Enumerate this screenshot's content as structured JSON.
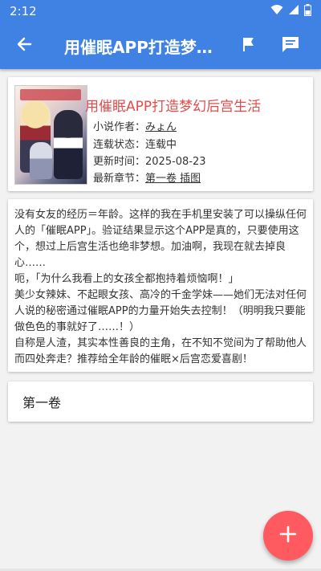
{
  "status_bar": {
    "time": "2:12"
  },
  "app_bar": {
    "title": "用催眠APP打造梦…",
    "back_icon": "arrow-left-icon",
    "actions": [
      "flag-icon",
      "comment-icon"
    ]
  },
  "book": {
    "title": "用催眠APP打造梦幻后宫生活",
    "author_label": "小说作者：",
    "author": "みょん",
    "status_label": "连载状态：",
    "status": "连载中",
    "updated_label": "更新时间：",
    "updated": "2025-08-23",
    "latest_label": "最新章节：",
    "latest": "第一卷 插图"
  },
  "description": {
    "paragraphs": [
      "没有女友的经历＝年龄。这样的我在手机里安装了可以操纵任何人的「催眠APP」。验证结果显示这个APP是真的，只要使用这个，想过上后宫生活也绝非梦想。加油啊，我现在就去掉良心……",
      "呃，「为什么我看上的女孩全都抱持着烦恼啊！」",
      "美少女辣妹、不起眼女孩、高冷的千金学妹——她们无法对任何人说的秘密通过催眠APP的力量开始失去控制！（明明我只要能做色色的事就好了……！）",
      "自称是人渣，其实本性善良的主角，在不知不觉间为了帮助他人而四处奔走？推荐给全年龄的催眠×后宫恋爱喜剧！"
    ]
  },
  "volumes": [
    {
      "label": "第一卷"
    }
  ],
  "fab": {
    "icon": "plus-icon"
  },
  "colors": {
    "primary": "#3f82e4",
    "accent": "#ff5a5f",
    "title_red": "#e34c4c"
  }
}
